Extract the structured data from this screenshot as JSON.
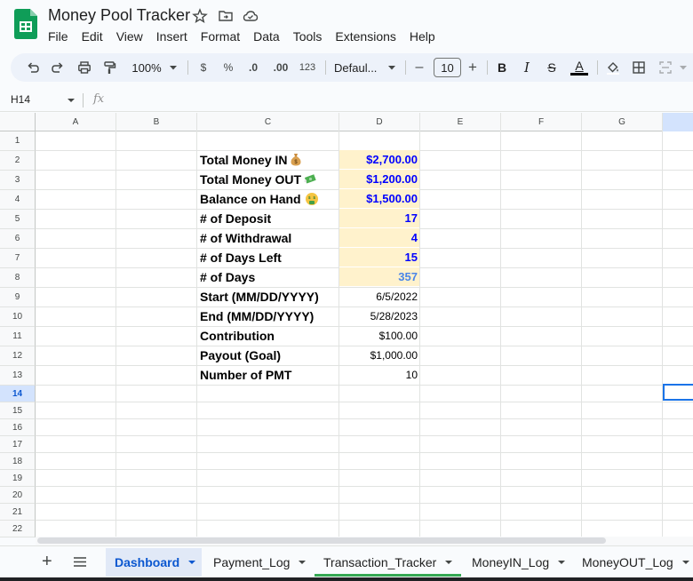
{
  "app": {
    "title": "Money Pool Tracker",
    "menu": [
      "File",
      "Edit",
      "View",
      "Insert",
      "Format",
      "Data",
      "Tools",
      "Extensions",
      "Help"
    ]
  },
  "toolbar": {
    "zoom": "100%",
    "currency": "$",
    "percent": "%",
    "dec_decrease": ".0",
    "dec_increase": ".00",
    "number_format": "123",
    "font": "Defaul...",
    "font_size": "10",
    "minus": "–",
    "plus": "+",
    "bold": "B",
    "italic": "I",
    "strike": "S",
    "text_color_letter": "A"
  },
  "formula_bar": {
    "name_box": "H14",
    "fx": "fx"
  },
  "columns": [
    "A",
    "B",
    "C",
    "D",
    "E",
    "F",
    "G"
  ],
  "rows": [
    "1",
    "2",
    "3",
    "4",
    "5",
    "6",
    "7",
    "8",
    "9",
    "10",
    "11",
    "12",
    "13",
    "14",
    "15",
    "16",
    "17",
    "18",
    "19",
    "20",
    "21",
    "22"
  ],
  "selected_row": "14",
  "dashboard": {
    "total_in_label": "Total Money IN",
    "total_in_value": "$2,700.00",
    "total_out_label": "Total Money OUT",
    "total_out_value": "$1,200.00",
    "balance_label": "Balance on Hand",
    "balance_value": "$1,500.00",
    "deposits_label": "# of Deposit",
    "deposits_value": "17",
    "withdrawals_label": "# of Withdrawal",
    "withdrawals_value": "4",
    "days_left_label": "# of Days Left",
    "days_left_value": "15",
    "days_label": "# of Days",
    "days_value": "357",
    "start_label": "Start (MM/DD/YYYY)",
    "start_value": "6/5/2022",
    "end_label": "End (MM/DD/YYYY)",
    "end_value": "5/28/2023",
    "contribution_label": "Contribution",
    "contribution_value": "$100.00",
    "payout_label": "Payout (Goal)",
    "payout_value": "$1,000.00",
    "pmt_label": "Number of PMT",
    "pmt_value": "10"
  },
  "sheet_tabs": [
    "Dashboard",
    "Payment_Log",
    "Transaction_Tracker",
    "MoneyIN_Log",
    "MoneyOUT_Log"
  ],
  "colors": {
    "highlight_fill": "#fff2cc",
    "value_blue": "#0000ff",
    "value_lightblue": "#4a86e8",
    "active_tab": "#0b57d0",
    "tab_underline": "#34a853"
  }
}
